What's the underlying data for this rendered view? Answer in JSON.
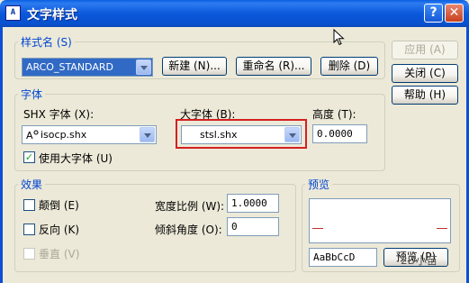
{
  "window": {
    "app_icon": "A",
    "title": "文字样式",
    "help_button": "?",
    "close_button": "✕"
  },
  "style_name": {
    "group_label": "样式名 (S)",
    "selected": "ARCO_STANDARD",
    "new_button": "新建 (N)...",
    "rename_button": "重命名 (R)...",
    "delete_button": "删除 (D)"
  },
  "side_buttons": {
    "apply": "应用 (A)",
    "close": "关闭 (C)",
    "help": "帮助 (H)"
  },
  "font": {
    "group_label": "字体",
    "shx_label": "SHX 字体 (X):",
    "shx_value": "isocp.shx",
    "bigfont_label": "大字体 (B):",
    "bigfont_value": "stsl.shx",
    "height_label": "高度 (T):",
    "height_value": "0.0000",
    "use_bigfont_label": "使用大字体 (U)",
    "use_bigfont_checked": "✓"
  },
  "effects": {
    "group_label": "效果",
    "upside_down_label": "颠倒 (E)",
    "backwards_label": "反向 (K)",
    "vertical_label": "垂直 (V)",
    "width_factor_label": "宽度比例 (W):",
    "width_factor_value": "1.0000",
    "oblique_label": "倾斜角度 (O):",
    "oblique_value": "0"
  },
  "preview": {
    "group_label": "预览",
    "sample_text": "AaBbCcD",
    "preview_button": "预览 (P)"
  },
  "watermark": "2D小苗"
}
